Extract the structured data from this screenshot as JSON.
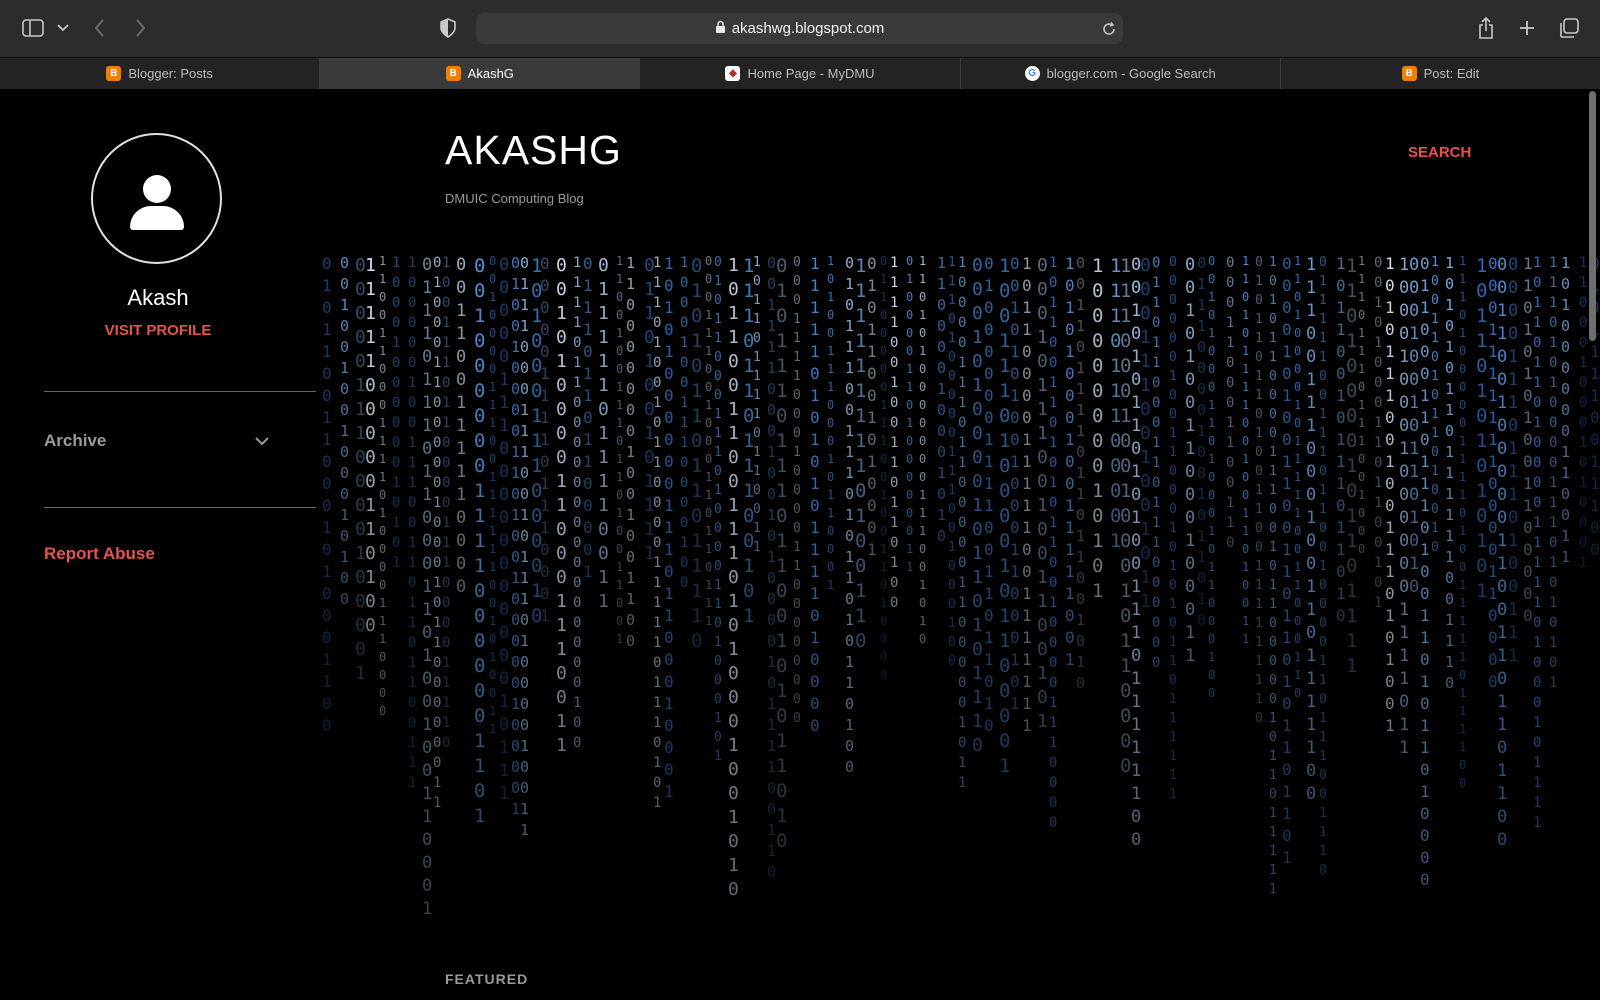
{
  "browser": {
    "url": "akashwg.blogspot.com",
    "tabs": [
      {
        "label": "Blogger: Posts",
        "icon": "blogger-icon",
        "active": false
      },
      {
        "label": "AkashG",
        "icon": "blogger-icon",
        "active": true
      },
      {
        "label": "Home Page - MyDMU",
        "icon": "dmu-icon",
        "active": false
      },
      {
        "label": "blogger.com - Google Search",
        "icon": "google-icon",
        "active": false
      },
      {
        "label": "Post: Edit",
        "icon": "blogger-icon",
        "active": false
      }
    ]
  },
  "sidebar": {
    "profile_name": "Akash",
    "visit_profile": "VISIT PROFILE",
    "archive_label": "Archive",
    "report_abuse": "Report Abuse"
  },
  "blog": {
    "title": "AKASHG",
    "subtitle": "DMUIC Computing Blog",
    "search_label": "SEARCH",
    "featured_label": "FEATURED"
  },
  "colors": {
    "accent": "#e5534b",
    "background": "#000000",
    "matrix_blue": "#4a8fe0"
  }
}
